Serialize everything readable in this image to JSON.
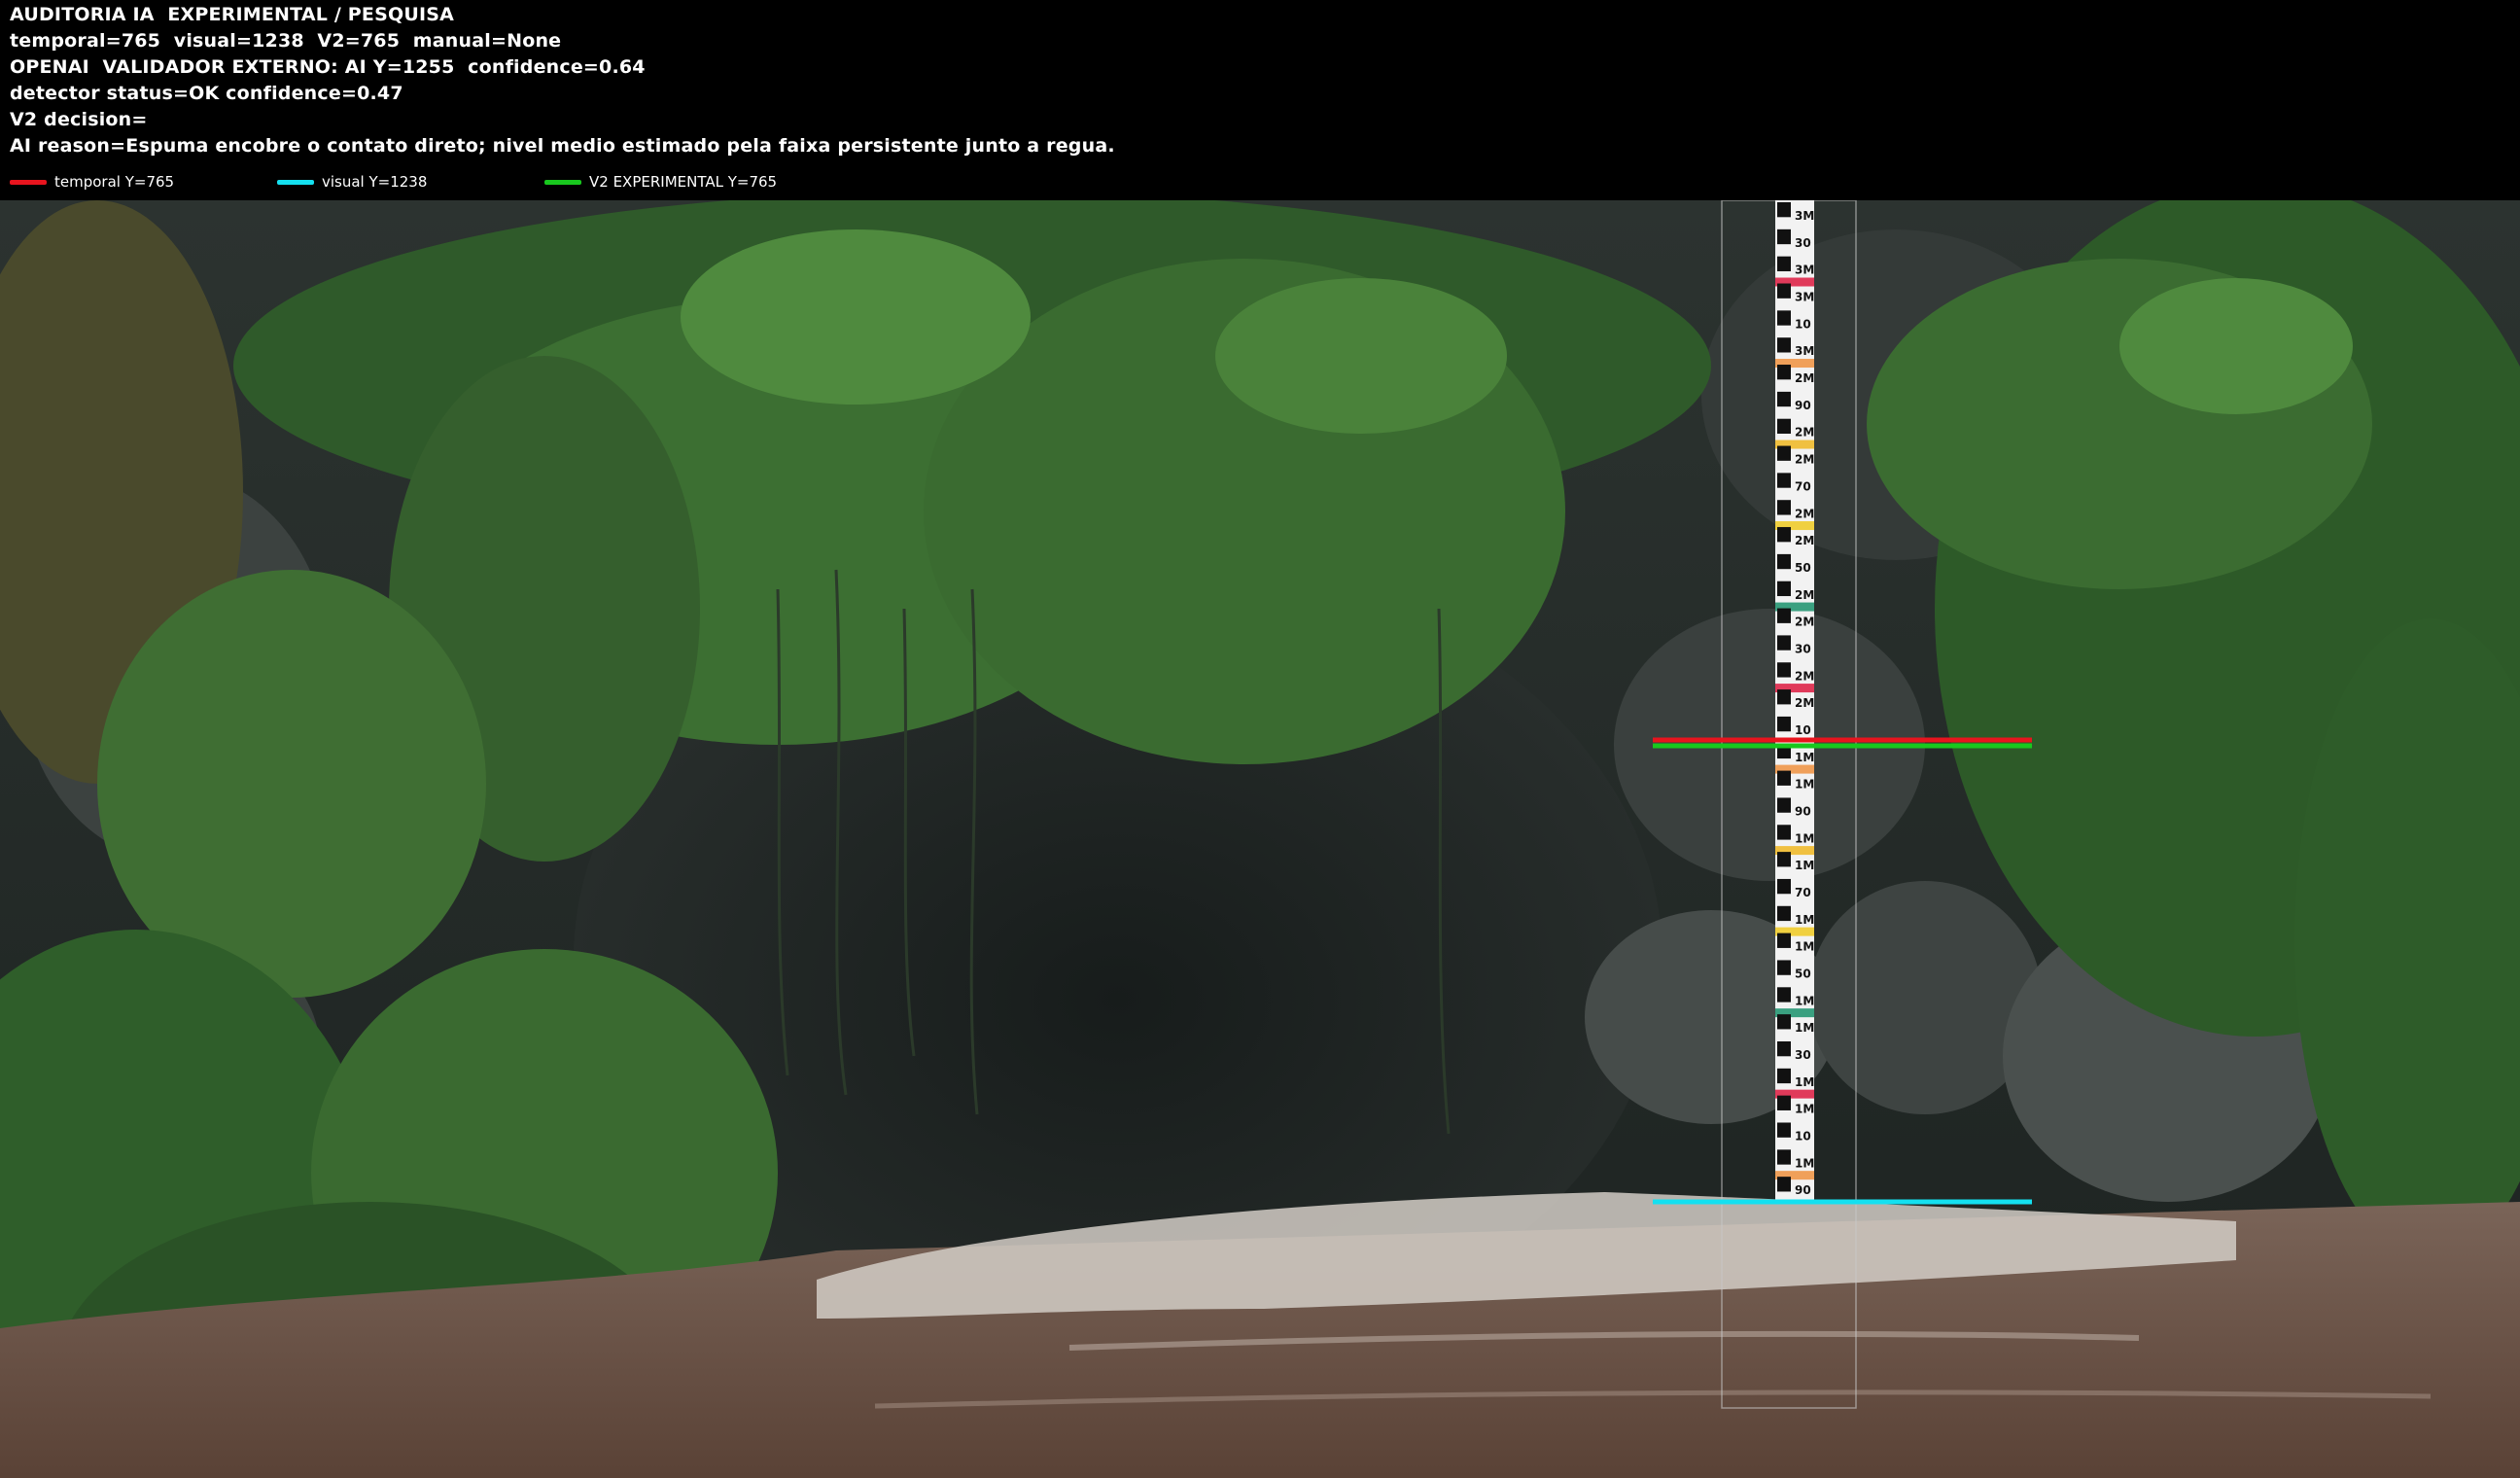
{
  "overlay": {
    "lines": [
      "AUDITORIA IA  EXPERIMENTAL / PESQUISA",
      "temporal=765  visual=1238  V2=765  manual=None",
      "OPENAI  VALIDADOR EXTERNO: AI Y=1255  confidence=0.64",
      "detector status=OK confidence=0.47",
      "V2 decision=",
      "AI reason=Espuma encobre o contato direto; nivel medio estimado pela faixa persistente junto a regua."
    ],
    "legend": [
      {
        "label": "temporal Y=765",
        "color": "#e8141e"
      },
      {
        "label": "visual Y=1238",
        "color": "#14e0f0"
      },
      {
        "label": "V2 EXPERIMENTAL Y=765",
        "color": "#18c81e"
      }
    ]
  },
  "gauge": {
    "marks": [
      "3M",
      "30",
      "3M",
      "3M",
      "10",
      "3M",
      "2M",
      "90",
      "2M",
      "2M",
      "70",
      "2M",
      "2M",
      "50",
      "2M",
      "2M",
      "30",
      "2M",
      "2M",
      "10",
      "1M",
      "1M",
      "90",
      "1M",
      "1M",
      "70",
      "1M",
      "1M",
      "50",
      "1M",
      "1M",
      "30",
      "1M",
      "1M",
      "10",
      "1M",
      "90"
    ]
  },
  "level_lines": {
    "temporal_color": "#e8141e",
    "v2_color": "#18c81e",
    "visual_color": "#14e0f0"
  }
}
